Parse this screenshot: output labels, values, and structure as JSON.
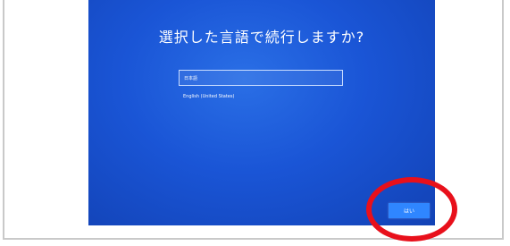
{
  "setup": {
    "title": "選択した言語で続行しますか?",
    "languages": [
      {
        "label": "日本語",
        "selected": true
      },
      {
        "label": "English (United States)",
        "selected": false
      }
    ],
    "yes_button": "はい"
  },
  "colors": {
    "screen_background": "#1a55d6",
    "button": "#2f86ff",
    "highlight": "#e8101b"
  }
}
